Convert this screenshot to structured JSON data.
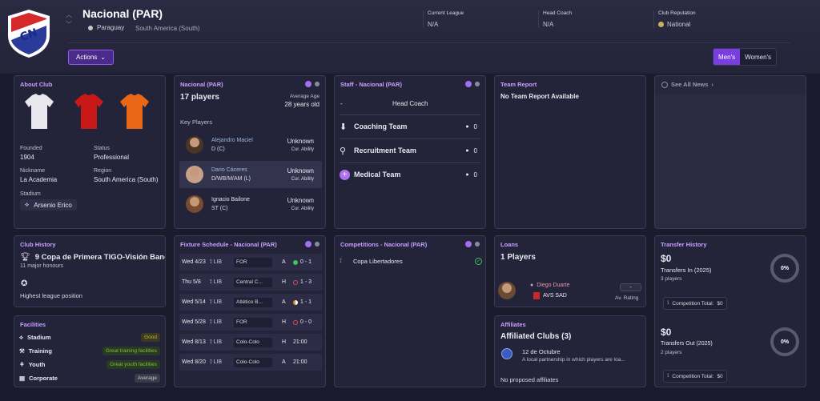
{
  "header": {
    "club_name": "Nacional (PAR)",
    "crest_text": "CN",
    "country": "Paraguay",
    "region": "South America (South)",
    "current_league_label": "Current League",
    "current_league_value": "N/A",
    "head_coach_label": "Head Coach",
    "head_coach_value": "N/A",
    "reputation_label": "Club Reputation",
    "reputation_value": "National",
    "actions_label": "Actions",
    "mens_label": "Men's",
    "womens_label": "Women's"
  },
  "about": {
    "title": "About Club",
    "founded_label": "Founded",
    "founded_value": "1904",
    "status_label": "Status",
    "status_value": "Professional",
    "nickname_label": "Nickname",
    "nickname_value": "La Academia",
    "region_label": "Region",
    "region_value": "South America (South)",
    "stadium_label": "Stadium",
    "stadium_value": "Arsenio Erico"
  },
  "squad": {
    "title": "Nacional (PAR)",
    "players_count": "17 players",
    "avg_age_label": "Average Age",
    "avg_age_value": "28 years old",
    "key_players_label": "Key Players",
    "players": [
      {
        "name": "Alejandro Maciel",
        "position": "D (C)",
        "ability": "Unknown",
        "ability_label": "Cur. Ability"
      },
      {
        "name": "Dario Cáceres",
        "position": "D/WB/M/AM (L)",
        "ability": "Unknown",
        "ability_label": "Cur. Ability"
      },
      {
        "name": "Ignacio Bailone",
        "position": "ST (C)",
        "ability": "Unknown",
        "ability_label": "Cur. Ability"
      }
    ]
  },
  "staff": {
    "title": "Staff - Nacional (PAR)",
    "head_coach_dash": "-",
    "head_coach_label": "Head Coach",
    "rows": [
      {
        "label": "Coaching Team",
        "count": "0"
      },
      {
        "label": "Recruitment Team",
        "count": "0"
      },
      {
        "label": "Medical Team",
        "count": "0"
      }
    ]
  },
  "report": {
    "title": "Team Report",
    "text": "No Team Report Available"
  },
  "news": {
    "link": "See All News"
  },
  "history": {
    "title": "Club History",
    "trophy_text": "9 Copa de Primera TIGO-Visión Banc",
    "major_honours": "11 major honours",
    "league_position": "Highest league position"
  },
  "fixtures": {
    "title": "Fixture Schedule - Nacional (PAR)",
    "rows": [
      {
        "date": "Wed 4/23",
        "comp": "LIB",
        "opp": "FOR",
        "ha": "A",
        "result": "0 - 1",
        "color": "#3ec45a"
      },
      {
        "date": "Thu 5/8",
        "comp": "LIB",
        "opp": "Central C...",
        "ha": "H",
        "result": "1 - 3",
        "color": "#e04848"
      },
      {
        "date": "Wed 5/14",
        "comp": "LIB",
        "opp": "Atlético B...",
        "ha": "A",
        "result": "1 - 1",
        "color": "#e09030"
      },
      {
        "date": "Wed 5/28",
        "comp": "LIB",
        "opp": "FOR",
        "ha": "H",
        "result": "0 - 0",
        "color": "#e04848"
      },
      {
        "date": "Wed 8/13",
        "comp": "LIB",
        "opp": "Colo-Colo",
        "ha": "H",
        "result": "21:00",
        "color": ""
      },
      {
        "date": "Wed 8/20",
        "comp": "LIB",
        "opp": "Colo-Colo",
        "ha": "A",
        "result": "21:00",
        "color": ""
      }
    ]
  },
  "competitions": {
    "title": "Competitions - Nacional (PAR)",
    "items": [
      {
        "name": "Copa Libertadores"
      }
    ]
  },
  "loans": {
    "title": "Loans",
    "count": "1 Players",
    "player_name": "Diego Duarte",
    "player_club": "AVS SAD",
    "rating": "-",
    "rating_label": "Av. Rating"
  },
  "affiliates": {
    "title": "Affiliates",
    "count": "Affiliated Clubs (3)",
    "club_name": "12 de Octubre",
    "club_desc": "A local partnership in which players are loa...",
    "proposed": "No proposed affiliates"
  },
  "facilities": {
    "title": "Facilities",
    "rows": [
      {
        "label": "Stadium",
        "value": "Good",
        "color": "#c8b040",
        "bg": "#3a3a22"
      },
      {
        "label": "Training",
        "value": "Great training facilities",
        "color": "#7ac040",
        "bg": "#2a3a22"
      },
      {
        "label": "Youth",
        "value": "Great youth facilities",
        "color": "#7ac040",
        "bg": "#2a3a22"
      },
      {
        "label": "Corporate",
        "value": "Average",
        "color": "#c8c8d0",
        "bg": "#3a3a48"
      }
    ]
  },
  "transfers": {
    "title": "Transfer History",
    "in_amount": "$0",
    "in_label": "Transfers In (2025)",
    "in_players": "3 players",
    "in_pct": "0%",
    "in_total_label": "Competition Total:",
    "in_total_value": "$0",
    "out_amount": "$0",
    "out_label": "Transfers Out (2025)",
    "out_players": "2 players",
    "out_pct": "0%",
    "out_total_label": "Competition Total:",
    "out_total_value": "$0"
  },
  "colors": {
    "accent": "#9a5cf0",
    "title": "#c9a0ff"
  }
}
